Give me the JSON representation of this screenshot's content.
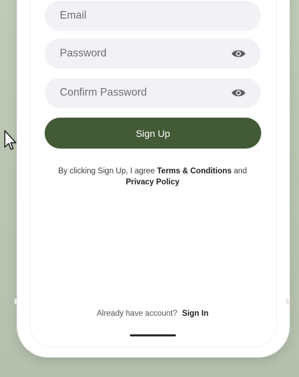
{
  "form": {
    "email_placeholder": "Email",
    "password_placeholder": "Password",
    "confirm_password_placeholder": "Confirm Password",
    "signup_label": "Sign Up"
  },
  "terms": {
    "prefix": "By clicking Sign Up, I agree ",
    "terms_link": "Terms & Conditions",
    "middle": " and",
    "privacy_link": "Privacy Policy"
  },
  "footer": {
    "prompt": "Already have account?",
    "signin_label": "Sign In"
  },
  "colors": {
    "accent": "#435a36",
    "input_bg": "#f2f2f6",
    "backdrop": "#bcc7b5"
  },
  "icons": {
    "password_toggle": "eye-icon",
    "confirm_toggle": "eye-icon",
    "cursor": "mouse-pointer-icon"
  }
}
